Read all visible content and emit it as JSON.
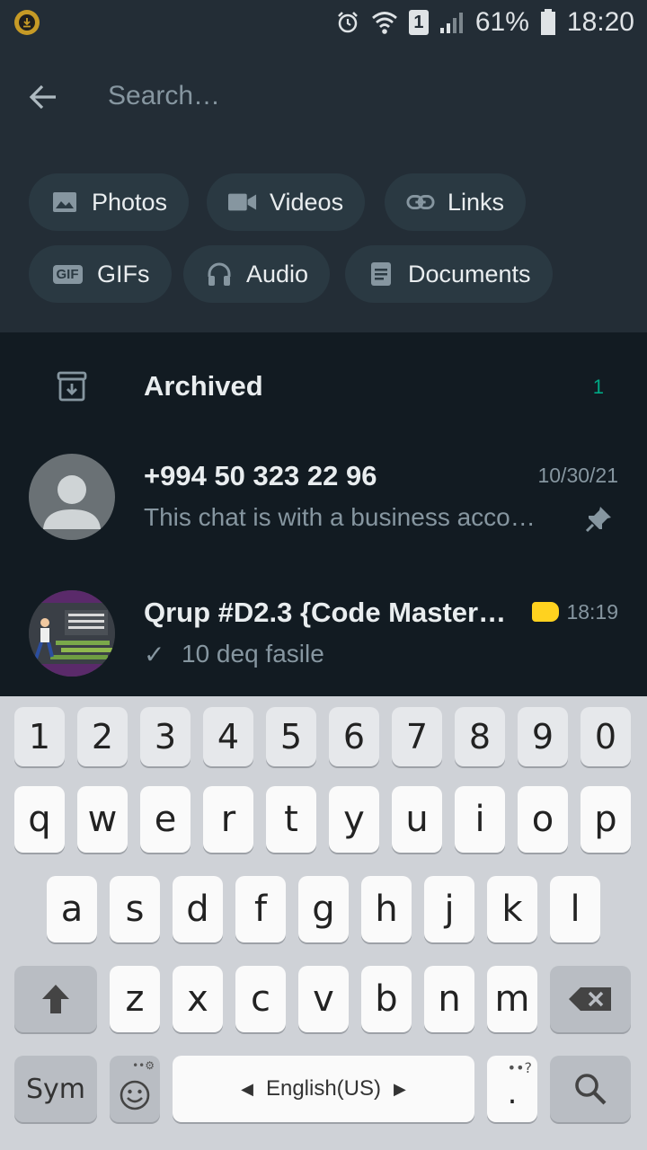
{
  "status_bar": {
    "battery_percent": "61%",
    "time": "18:20",
    "sim_number": "1",
    "icons": [
      "download-icon",
      "alarm-icon",
      "wifi-icon",
      "sim-icon",
      "signal-icon",
      "battery-icon"
    ]
  },
  "search": {
    "placeholder": "Search…",
    "filters": [
      {
        "label": "Photos",
        "icon": "image-icon"
      },
      {
        "label": "Videos",
        "icon": "video-icon"
      },
      {
        "label": "Links",
        "icon": "link-icon"
      },
      {
        "label": "GIFs",
        "icon": "gif-icon"
      },
      {
        "label": "Audio",
        "icon": "headphones-icon"
      },
      {
        "label": "Documents",
        "icon": "document-icon"
      }
    ]
  },
  "archived": {
    "label": "Archived",
    "count": "1"
  },
  "chats": [
    {
      "name": "+994 50 323 22 96",
      "time": "10/30/21",
      "message": "This chat is with a business acco…",
      "pinned": true
    },
    {
      "name": "Qrup #D2.3 {Code Master…",
      "time": "18:19",
      "message": "10 deq fasile",
      "label_color": "#ffd21f",
      "tick": "✓"
    }
  ],
  "keyboard": {
    "numbers": [
      "1",
      "2",
      "3",
      "4",
      "5",
      "6",
      "7",
      "8",
      "9",
      "0"
    ],
    "row1": [
      "q",
      "w",
      "e",
      "r",
      "t",
      "y",
      "u",
      "i",
      "o",
      "p"
    ],
    "row2": [
      "a",
      "s",
      "d",
      "f",
      "g",
      "h",
      "j",
      "k",
      "l"
    ],
    "row3": [
      "z",
      "x",
      "c",
      "v",
      "b",
      "n",
      "m"
    ],
    "sym_label": "Sym",
    "space_label": "English(US)",
    "period": ".",
    "extra_glyphs": {
      "dots_q": "••?"
    }
  },
  "colors": {
    "accent": "#00a884",
    "header_bg": "#232d36",
    "chat_bg": "#121b22"
  }
}
